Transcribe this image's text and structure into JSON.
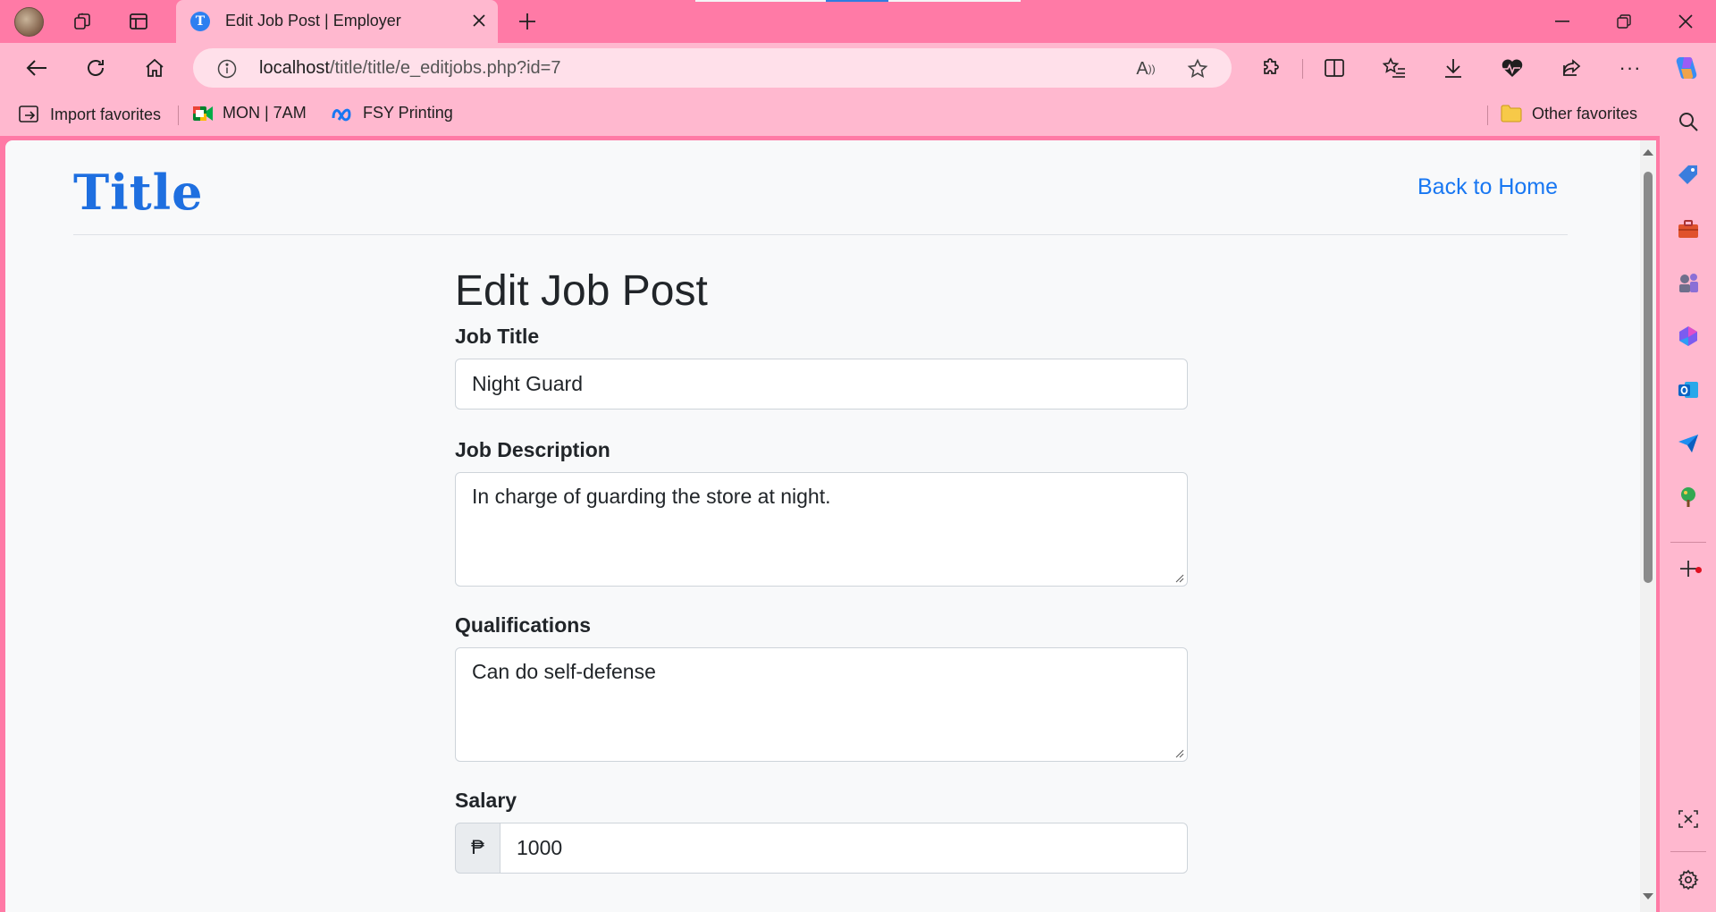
{
  "browser": {
    "tab_title": "Edit Job Post | Employer",
    "url_host": "localhost",
    "url_path": "/title/title/e_editjobs.php?id=7",
    "favorites": [
      {
        "label": "Import favorites"
      },
      {
        "label": "MON | 7AM"
      },
      {
        "label": "FSY Printing"
      }
    ],
    "other_favorites": "Other favorites"
  },
  "page": {
    "brand": "Title",
    "home_link": "Back to Home",
    "heading": "Edit Job Post",
    "fields": {
      "job_title": {
        "label": "Job Title",
        "value": "Night Guard"
      },
      "job_description": {
        "label": "Job Description",
        "value": "In charge of guarding the store at night."
      },
      "qualifications": {
        "label": "Qualifications",
        "value": "Can do self-defense"
      },
      "salary": {
        "label": "Salary",
        "currency": "₱",
        "value": "1000"
      }
    }
  },
  "colors": {
    "chrome_pink": "#ff7aa6",
    "toolbar_pink": "#ffb8cf",
    "link_blue": "#1877f2"
  }
}
